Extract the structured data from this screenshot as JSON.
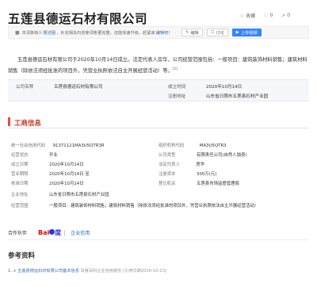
{
  "title": "五莲县德运石材有限公司",
  "actions": [
    {
      "icon": "star-icon",
      "label": "收藏"
    },
    {
      "icon": "thumb-up-icon",
      "label": "0"
    },
    {
      "icon": "share-icon",
      "label": "0"
    }
  ],
  "notice": {
    "text_a": "本词条缺少",
    "link1": "概述图",
    "text_b": "，补充相关内容使词条更完整，还能快速升级，",
    "link2": "赶紧来",
    "text_c": "编辑吧！"
  },
  "buttons": {
    "edit": "编辑",
    "discuss": "讨论",
    "upload": "上传视频"
  },
  "summary": {
    "text": "五莲县德运石材有限公司于2020年10月14日成立。法定代表人房华，公司经营范围包括：一般项目：建筑装饰材料销售；建筑材料销售（除依法须经批准的项目外，凭营业执照依法自主开展经营活动）等。",
    "ref": "[1]"
  },
  "infobox": {
    "row1_left_label": "公司名称",
    "row1_left_value": "五莲县德运石材有限公司",
    "row1_right_label": "成立时间",
    "row1_right_value": "2020年10月14日",
    "row2_right_label": "注册地址",
    "row2_right_value": "山东省日照市五莲县石材产业园"
  },
  "section": {
    "title": "工商信息"
  },
  "business": {
    "credit_code_label": "统一社会信用代码",
    "credit_code": "91371121MA3U5QTR3R",
    "reg_no_label": "组织机构代码",
    "reg_no": "MA3U5QTR3",
    "status_label": "经营状态",
    "status": "开业",
    "type_label": "公司类型",
    "type": "有限责任公司(自然人独资)",
    "founded_label": "成立日期",
    "founded": "2020年10月14日",
    "rep_label": "法定代表人",
    "rep": "房华",
    "term_label": "营业期限",
    "term": "2020年10月14日 至",
    "capital_label": "注册资本",
    "capital": "300万(元)",
    "approve_label": "核准日期",
    "approve": "2020年10月14日",
    "authority_label": "登记机关",
    "authority": "五莲县市场监督管理局",
    "address_label": "企业地址",
    "address": "山东省日照市五莲县石材产业园",
    "scope_label": "经营范围",
    "scope": "一般项目：建筑装饰材料销售；建筑材料销售（除依法须经批准的项目外，凭营业执照依法自主开展经营活动）"
  },
  "coop": {
    "label": "合作伙伴",
    "bai": "Bai",
    "du": "度",
    "qx": "企业信用"
  },
  "refs": {
    "title": "参考资料",
    "item_num": "1.",
    "item_arrow": "∧",
    "item_link": "五莲县德运石材有限公司基本信息",
    "item_source": "百度百科企业信用服务",
    "item_date": "[引用日期2020-10-23]"
  }
}
